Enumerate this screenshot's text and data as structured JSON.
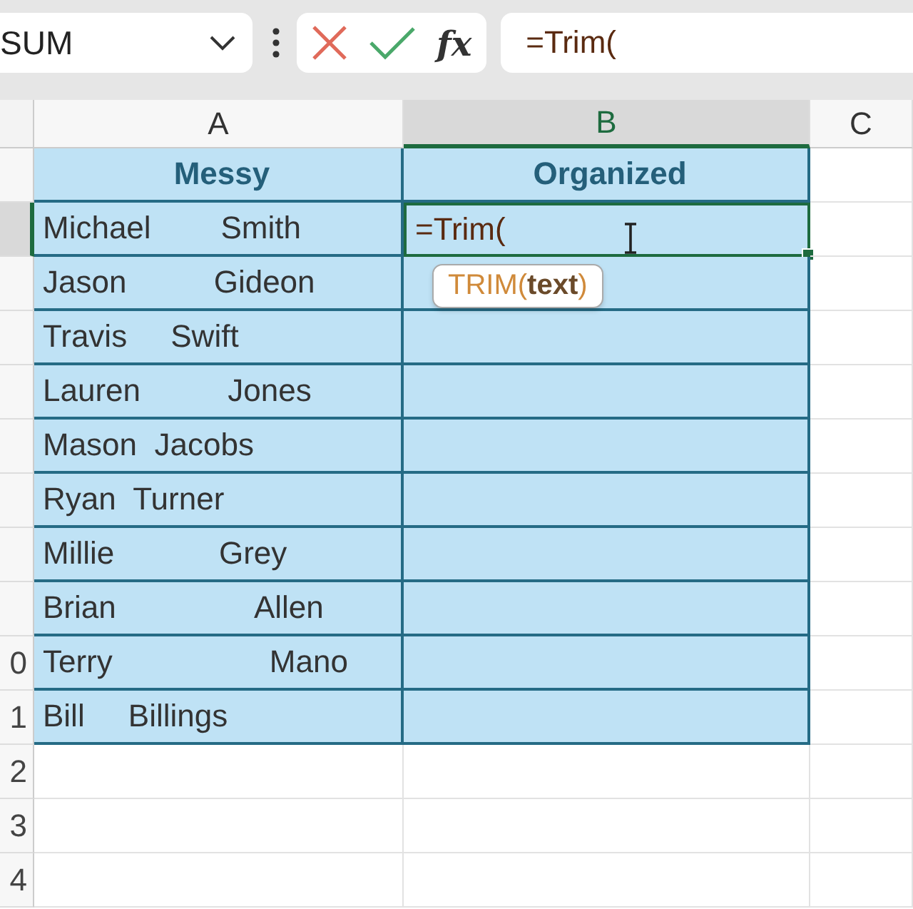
{
  "name_box": {
    "value": "SUM"
  },
  "formula_bar": {
    "buttons": [
      {
        "kind": "cancel"
      },
      {
        "kind": "enter"
      },
      {
        "kind": "function",
        "label": "fx"
      }
    ],
    "value": "=Trim("
  },
  "columns": [
    {
      "label": "A",
      "selected": false
    },
    {
      "label": "B",
      "selected": true
    },
    {
      "label": "C",
      "selected": false
    }
  ],
  "rows": [
    {
      "kind": "header",
      "selected": false,
      "cells": [
        {
          "text": "Messy",
          "active": false
        },
        {
          "text": "Organized",
          "active": false
        }
      ]
    },
    {
      "kind": "data",
      "selected": true,
      "cells": [
        {
          "text": "Michael        Smith",
          "active": false
        },
        {
          "text": "=Trim(",
          "active": true,
          "tooltip": "TRIM(**text**)"
        }
      ]
    },
    {
      "kind": "data",
      "selected": false,
      "cells": [
        {
          "text": "Jason          Gideon",
          "active": false
        }
      ]
    },
    {
      "kind": "data",
      "selected": false,
      "cells": [
        {
          "text": "Travis     Swift",
          "active": false
        }
      ]
    },
    {
      "kind": "data",
      "selected": false,
      "cells": [
        {
          "text": "Lauren          Jones",
          "active": false
        }
      ]
    },
    {
      "kind": "data",
      "selected": false,
      "cells": [
        {
          "text": "Mason  Jacobs",
          "active": false
        }
      ]
    },
    {
      "kind": "data",
      "selected": false,
      "cells": [
        {
          "text": "Ryan  Turner",
          "active": false
        }
      ]
    },
    {
      "kind": "data",
      "selected": false,
      "cells": [
        {
          "text": "Millie            Grey",
          "active": false
        }
      ]
    },
    {
      "kind": "data",
      "selected": false,
      "cells": [
        {
          "text": "Brian                Allen",
          "active": false
        }
      ]
    },
    {
      "kind": "data",
      "number": "0",
      "selected": false,
      "cells": [
        {
          "text": "Terry                  Mano",
          "active": false
        }
      ]
    },
    {
      "kind": "data",
      "number": "1",
      "selected": false,
      "cells": [
        {
          "text": "Bill     Billings",
          "active": false
        }
      ]
    },
    {
      "kind": "empty",
      "number": "2",
      "selected": false
    },
    {
      "kind": "empty",
      "number": "3",
      "selected": false
    },
    {
      "kind": "empty",
      "number": "4",
      "selected": false
    }
  ]
}
